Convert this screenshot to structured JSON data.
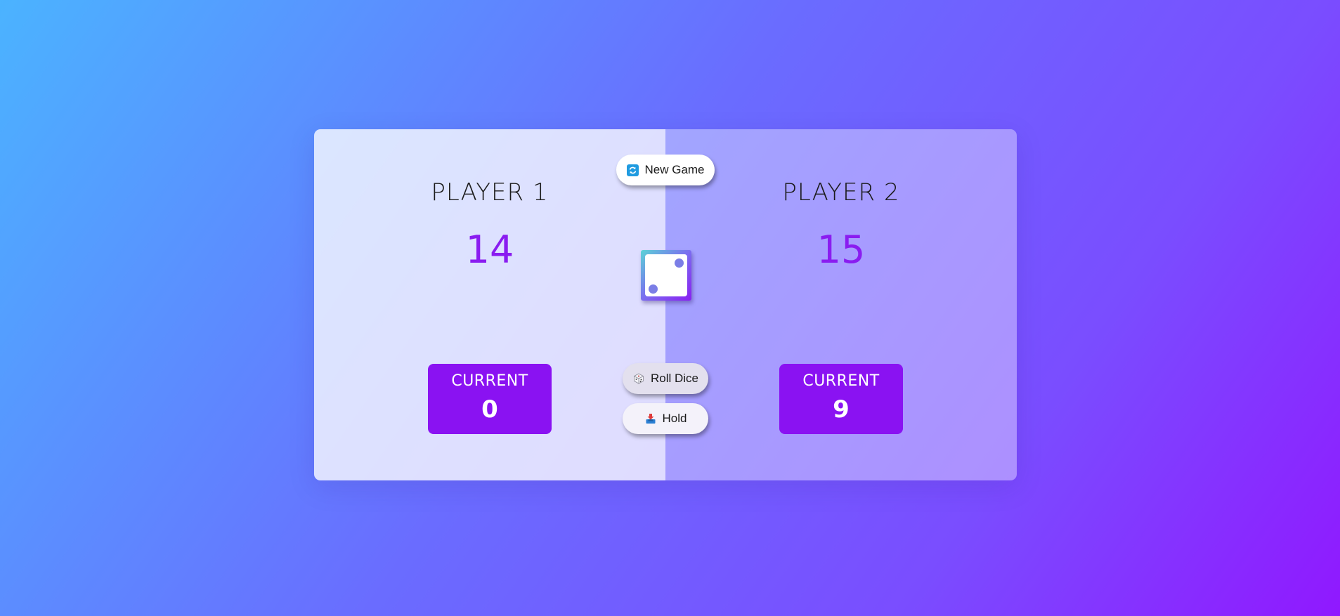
{
  "players": [
    {
      "name": "PLAYER 1",
      "score": "14",
      "current_label": "CURRENT",
      "current": "0"
    },
    {
      "name": "PLAYER 2",
      "score": "15",
      "current_label": "CURRENT",
      "current": "9"
    }
  ],
  "buttons": {
    "new_game": {
      "label": "New Game",
      "icon": "refresh-icon"
    },
    "roll_dice": {
      "label": "Roll Dice",
      "icon": "dice-icon"
    },
    "hold": {
      "label": "Hold",
      "icon": "inbox-tray-icon"
    }
  },
  "dice": {
    "value": 2,
    "icon": "dice-face-two-icon"
  },
  "colors": {
    "accent": "#8a12f2",
    "score": "#8a1cf0",
    "pip": "#7b7ee6"
  }
}
